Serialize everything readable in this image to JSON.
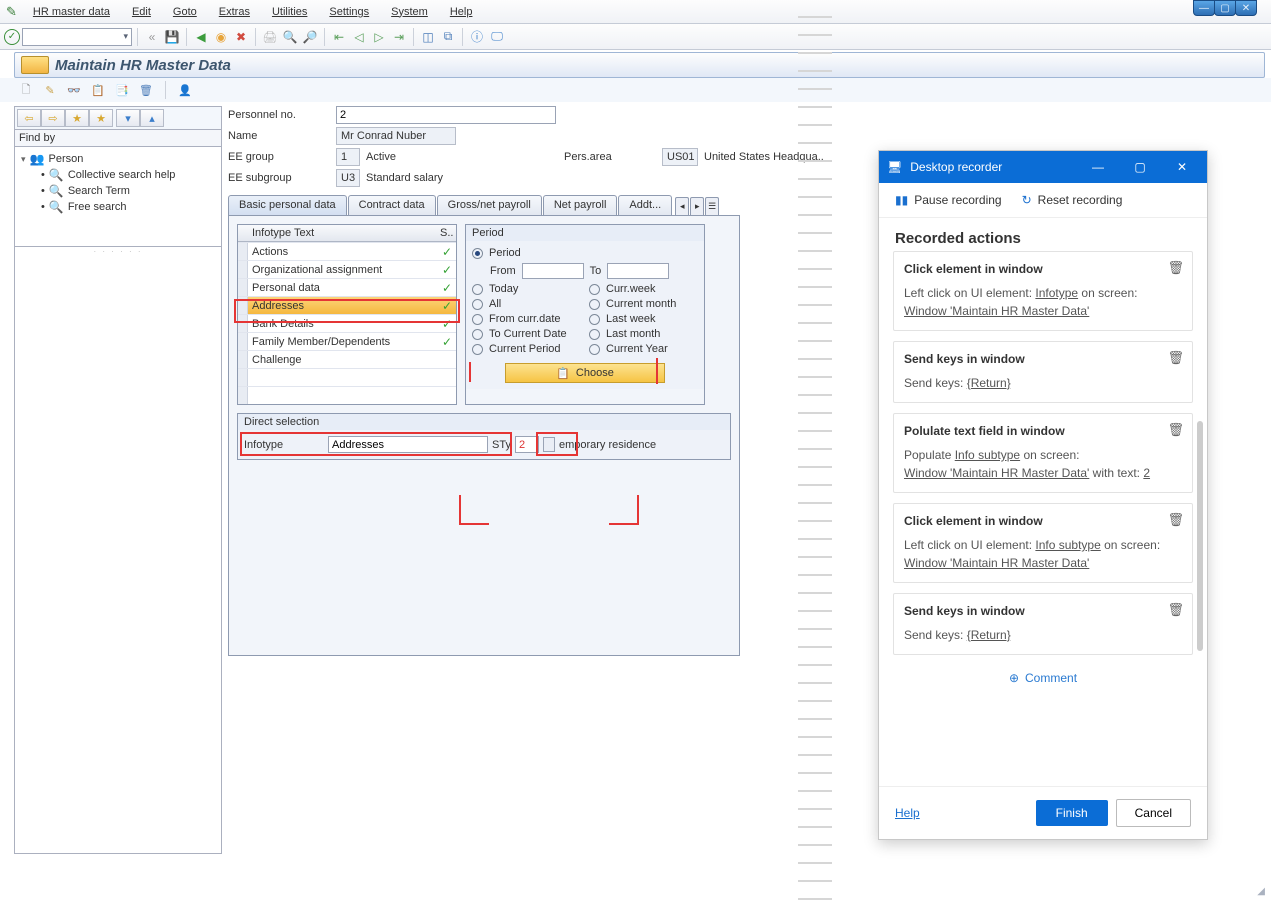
{
  "menu": [
    "HR master data",
    "Edit",
    "Goto",
    "Extras",
    "Utilities",
    "Settings",
    "System",
    "Help"
  ],
  "page_title": "Maintain HR Master Data",
  "findby_label": "Find by",
  "tree": {
    "root": "Person",
    "items": [
      "Collective search help",
      "Search Term",
      "Free search"
    ]
  },
  "header_form": {
    "labels": {
      "pers_no": "Personnel no.",
      "name": "Name",
      "eegroup": "EE group",
      "active": "Active",
      "persarea": "Pers.area",
      "us_text": "United States Headqua..",
      "eesub": "EE subgroup",
      "std_salary": "Standard salary"
    },
    "pers_no_value": "2",
    "name_value": "Mr Conrad Nuber",
    "eegroup_code": "1",
    "persarea_code": "US01",
    "eesub_code": "U3"
  },
  "tabs": [
    "Basic personal data",
    "Contract data",
    "Gross/net payroll",
    "Net payroll",
    "Addt..."
  ],
  "infotype": {
    "header_text": "Infotype Text",
    "header_s": "S..",
    "rows": [
      {
        "text": "Actions",
        "checked": true
      },
      {
        "text": "Organizational assignment",
        "checked": true
      },
      {
        "text": "Personal data",
        "checked": true
      },
      {
        "text": "Addresses",
        "checked": true,
        "selected": true
      },
      {
        "text": "Bank Details",
        "checked": true
      },
      {
        "text": "Family Member/Dependents",
        "checked": true
      },
      {
        "text": "Challenge",
        "checked": false
      }
    ]
  },
  "period": {
    "title": "Period",
    "radios": {
      "period": "Period",
      "from": "From",
      "to": "To",
      "today": "Today",
      "cw": "Curr.week",
      "all": "All",
      "cm": "Current month",
      "fcd": "From curr.date",
      "lw": "Last week",
      "tcd": "To Current Date",
      "lm": "Last month",
      "cp": "Current Period",
      "cy": "Current Year"
    },
    "choose": "Choose"
  },
  "direct_sel": {
    "title": "Direct selection",
    "infotype_label": "Infotype",
    "infotype_value": "Addresses",
    "sty_label": "STy",
    "sty_value": "2",
    "trail": "emporary residence"
  },
  "recorder": {
    "title": "Desktop recorder",
    "pause": "Pause recording",
    "reset": "Reset recording",
    "section": "Recorded actions",
    "actions": [
      {
        "title": "Click element in window",
        "body_pre": "Left click on UI element: ",
        "link1": "Infotype",
        "mid": " on screen:",
        "link2": "Window 'Maintain HR Master Data'"
      },
      {
        "title": "Send keys in window",
        "body_pre": "Send keys: ",
        "link1": "{Return}"
      },
      {
        "title": "Polulate text field in window",
        "body_pre": "Populate ",
        "link1": "Info subtype",
        "mid": " on screen:",
        "link2": "Window 'Maintain HR Master Data'",
        "mid2": " with text: ",
        "link3": "2"
      },
      {
        "title": "Click element in window",
        "body_pre": "Left click on UI element: ",
        "link1": "Info subtype",
        "mid": " on screen:",
        "link2": "Window 'Maintain HR Master Data'"
      },
      {
        "title": "Send keys in window",
        "body_pre": "Send keys: ",
        "link1": "{Return}"
      }
    ],
    "comment": "Comment",
    "help": "Help",
    "finish": "Finish",
    "cancel": "Cancel"
  }
}
